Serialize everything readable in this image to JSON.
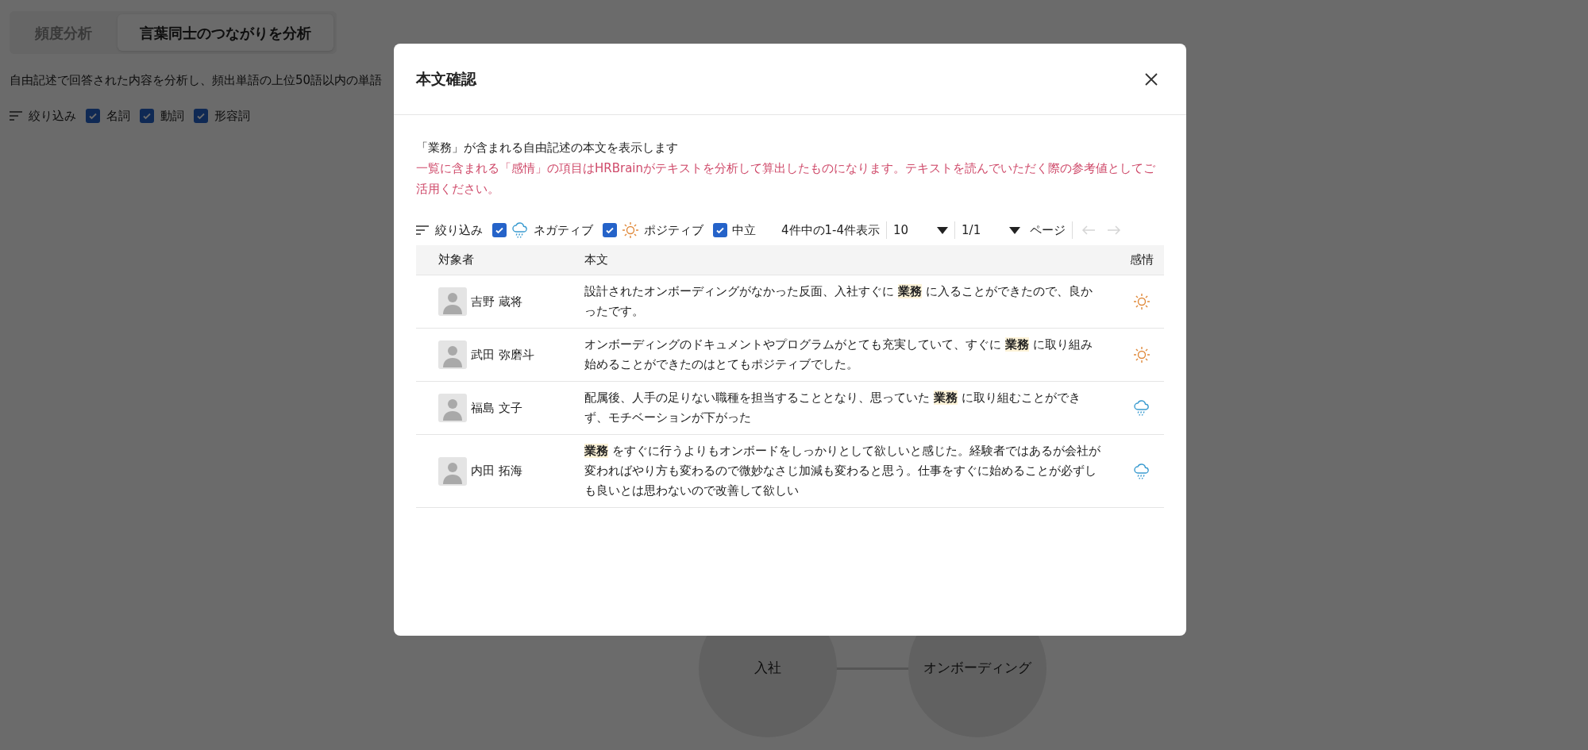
{
  "page_tabs": [
    {
      "label": "頻度分析",
      "selected": false
    },
    {
      "label": "言葉同士のつながりを分析",
      "selected": true
    }
  ],
  "description": "自由記述で回答された内容を分析し、頻出単語の上位50語以内の単語",
  "filter": {
    "label": "絞り込み",
    "options": [
      {
        "label": "名詞",
        "checked": true
      },
      {
        "label": "動詞",
        "checked": true
      },
      {
        "label": "形容詞",
        "checked": true
      }
    ]
  },
  "graph": {
    "nodes": [
      {
        "label": "入社"
      },
      {
        "label": "オンボーディング"
      }
    ]
  },
  "dialog": {
    "title": "本文確認",
    "intro": "「業務」が含まれる自由記述の本文を表示します",
    "notice": "一覧に含まれる「感情」の項目はHRBrainがテキストを分析して算出したものになります。テキストを読んでいただく際の参考値としてご活用ください。",
    "filter": {
      "label": "絞り込み",
      "options": [
        {
          "label": "ネガティブ",
          "kind": "negative",
          "checked": true
        },
        {
          "label": "ポジティブ",
          "kind": "positive",
          "checked": true
        },
        {
          "label": "中立",
          "kind": "neutral",
          "checked": true
        }
      ]
    },
    "pagination": {
      "summary": "4件中の1-4件表示",
      "per_page": "10",
      "page": "1/1",
      "page_label": "ページ",
      "prev_disabled": true,
      "next_disabled": true
    },
    "table": {
      "columns": [
        "対象者",
        "本文",
        "感情"
      ],
      "rows": [
        {
          "name": "吉野 蔵将",
          "kind": "positive",
          "body": "設計されたオンボーディングがなかった反面、入社すぐに **業務** に入ることができたので、良かったです。"
        },
        {
          "name": "武田 弥磨斗",
          "kind": "positive",
          "body": "オンボーディングのドキュメントやプログラムがとても充実していて、すぐに **業務** に取り組み始めることができたのはとてもポジティブでした。"
        },
        {
          "name": "福島 文子",
          "kind": "negative",
          "body": "配属後、人手の足りない職種を担当することとなり、思っていた **業務** に取り組むことができず、モチベーションが下がった"
        },
        {
          "name": "内田 拓海",
          "kind": "negative",
          "body": "**業務** をすぐに行うよりもオンボードをしっかりとして欲しいと感じた。経験者ではあるが会社が変わればやり方も変わるので微妙なさじ加減も変わると思う。仕事をすぐに始めることが必ずしも良いとは思わないので改善して欲しい"
        }
      ]
    }
  }
}
